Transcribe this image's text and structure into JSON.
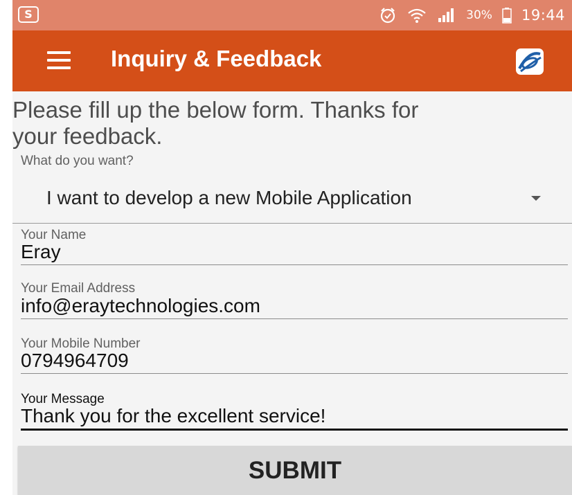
{
  "status_bar": {
    "app_icon": "S",
    "icons": [
      "alarm-icon",
      "wifi-icon",
      "signal-icon",
      "battery-icon"
    ],
    "battery_percent": "30%",
    "time": "19:44"
  },
  "app_bar": {
    "title": "Inquiry & Feedback",
    "menu_icon": "hamburger-menu-icon",
    "logo_icon": "app-logo-icon"
  },
  "form": {
    "intro": "Please fill up the below form. Thanks for\nyour feedback.",
    "want_label": "What do you want?",
    "want_value": "I want to develop a new Mobile Application",
    "name_label": "Your Name",
    "name_value": "Eray",
    "email_label": "Your Email Address",
    "email_value": "info@eraytechnologies.com",
    "mobile_label": "Your Mobile Number",
    "mobile_value": "0794964709",
    "message_label": "Your Message",
    "message_value": "Thank you for the excellent service!",
    "submit_label": "SUBMIT"
  },
  "colors": {
    "status_bar": "#e0846a",
    "app_bar": "#d44f18",
    "background": "#f4f4f4",
    "button": "#d8d8d8"
  }
}
